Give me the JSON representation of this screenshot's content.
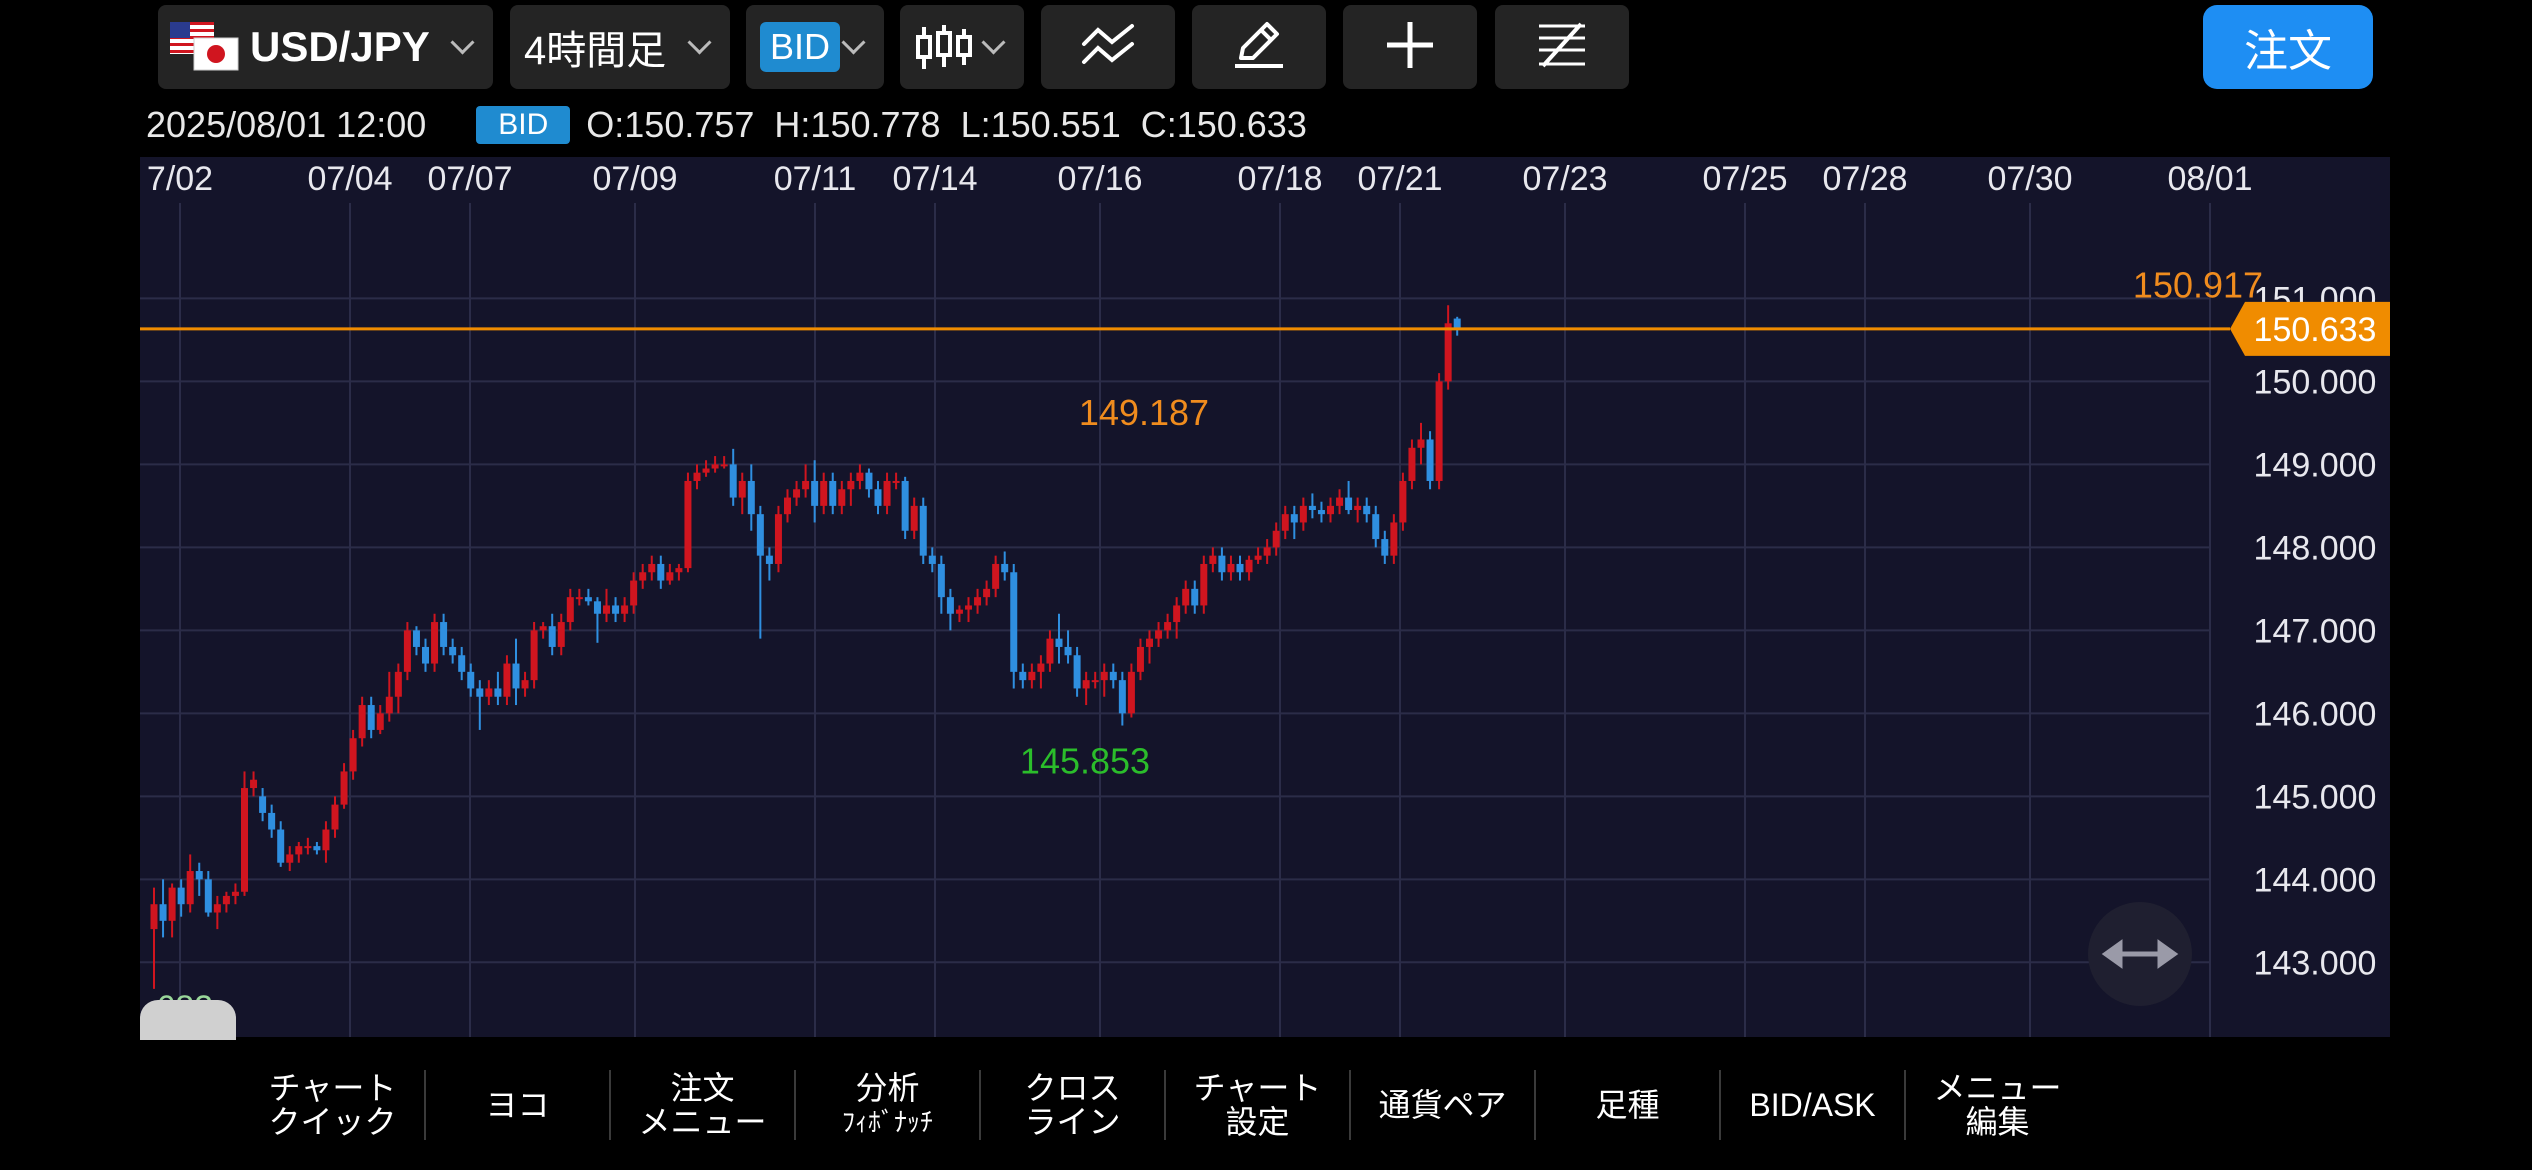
{
  "toolbar": {
    "pair": "USD/JPY",
    "timeframe": "4時間足",
    "price_side": "BID",
    "order_label": "注文",
    "icons": [
      "flag-us-jp-icon",
      "candlestick-icon",
      "indicator-lines-icon",
      "pencil-draw-icon",
      "crosshair-icon",
      "fibonacci-lines-icon"
    ]
  },
  "ohlc": {
    "datetime": "2025/08/01 12:00",
    "side": "BID",
    "open": "O:150.757",
    "high": "H:150.778",
    "low": "L:150.551",
    "close": "C:150.633"
  },
  "chart_annotations": {
    "current_price": "150.633",
    "high_label": "149.187",
    "low_label": "145.853",
    "recent_high_label": "150.917",
    "left_low_label": ".682"
  },
  "colors": {
    "up": "#d0151f",
    "down": "#2f8fe0",
    "price_line": "#f08c00",
    "high_text": "#f08c1e",
    "low_text": "#2bbd2b",
    "background": "#14142a",
    "order_button": "#1e8ef3"
  },
  "bottom_menu": [
    {
      "line1": "チャート",
      "line2": "クイック"
    },
    {
      "line1": "ヨコ",
      "line2": ""
    },
    {
      "line1": "注文",
      "line2": "メニュー"
    },
    {
      "line1": "分析",
      "line2": "ﾌｨﾎﾞﾅｯﾁ"
    },
    {
      "line1": "クロス",
      "line2": "ライン"
    },
    {
      "line1": "チャート",
      "line2": "設定"
    },
    {
      "line1": "通貨ペア",
      "line2": ""
    },
    {
      "line1": "足種",
      "line2": ""
    },
    {
      "line1": "BID/ASK",
      "line2": ""
    },
    {
      "line1": "メニュー",
      "line2": "編集"
    }
  ],
  "chart_data": {
    "type": "candlestick",
    "x_tick_labels": [
      "7/02",
      "07/04",
      "07/07",
      "07/09",
      "07/11",
      "07/14",
      "07/16",
      "07/18",
      "07/21",
      "07/23",
      "07/25",
      "07/28",
      "07/30",
      "08/01"
    ],
    "y_tick_labels": [
      "151.000",
      "150.000",
      "149.000",
      "148.000",
      "147.000",
      "146.000",
      "145.000",
      "144.000",
      "143.000"
    ],
    "y_range": [
      142.1,
      151.8
    ],
    "current_price": 150.633,
    "grid": true,
    "candles": [
      [
        143.4,
        143.9,
        142.68,
        143.7
      ],
      [
        143.7,
        144.0,
        143.3,
        143.5
      ],
      [
        143.5,
        143.95,
        143.3,
        143.9
      ],
      [
        143.9,
        144.0,
        143.55,
        143.7
      ],
      [
        143.7,
        144.3,
        143.6,
        144.1
      ],
      [
        144.1,
        144.2,
        143.8,
        144.0
      ],
      [
        144.0,
        144.1,
        143.55,
        143.6
      ],
      [
        143.6,
        143.8,
        143.4,
        143.7
      ],
      [
        143.7,
        143.85,
        143.6,
        143.8
      ],
      [
        143.8,
        143.95,
        143.7,
        143.85
      ],
      [
        143.85,
        145.3,
        143.8,
        145.1
      ],
      [
        145.1,
        145.3,
        145.0,
        145.2
      ],
      [
        145.0,
        145.1,
        144.7,
        144.8
      ],
      [
        144.8,
        144.9,
        144.5,
        144.6
      ],
      [
        144.6,
        144.7,
        144.15,
        144.2
      ],
      [
        144.2,
        144.4,
        144.1,
        144.3
      ],
      [
        144.3,
        144.45,
        144.2,
        144.4
      ],
      [
        144.4,
        144.5,
        144.3,
        144.4
      ],
      [
        144.4,
        144.45,
        144.3,
        144.35
      ],
      [
        144.35,
        144.7,
        144.2,
        144.6
      ],
      [
        144.6,
        145.0,
        144.5,
        144.9
      ],
      [
        144.9,
        145.4,
        144.85,
        145.3
      ],
      [
        145.3,
        145.8,
        145.2,
        145.7
      ],
      [
        145.7,
        146.2,
        145.6,
        146.1
      ],
      [
        146.1,
        146.2,
        145.7,
        145.8
      ],
      [
        145.8,
        146.1,
        145.75,
        146.0
      ],
      [
        146.0,
        146.5,
        145.9,
        146.2
      ],
      [
        146.2,
        146.6,
        146.0,
        146.5
      ],
      [
        146.5,
        147.1,
        146.4,
        147.0
      ],
      [
        147.0,
        147.05,
        146.7,
        146.8
      ],
      [
        146.8,
        146.9,
        146.5,
        146.6
      ],
      [
        146.6,
        147.2,
        146.5,
        147.1
      ],
      [
        147.1,
        147.2,
        146.7,
        146.8
      ],
      [
        146.8,
        146.9,
        146.6,
        146.7
      ],
      [
        146.7,
        146.8,
        146.4,
        146.5
      ],
      [
        146.5,
        146.6,
        146.2,
        146.3
      ],
      [
        146.3,
        146.4,
        145.8,
        146.2
      ],
      [
        146.2,
        146.4,
        146.1,
        146.3
      ],
      [
        146.3,
        146.5,
        146.1,
        146.2
      ],
      [
        146.2,
        146.7,
        146.1,
        146.6
      ],
      [
        146.6,
        146.9,
        146.1,
        146.3
      ],
      [
        146.3,
        146.5,
        146.2,
        146.4
      ],
      [
        146.4,
        147.1,
        146.3,
        147.0
      ],
      [
        147.0,
        147.1,
        146.9,
        147.05
      ],
      [
        147.05,
        147.2,
        146.7,
        146.8
      ],
      [
        146.8,
        147.2,
        146.7,
        147.1
      ],
      [
        147.1,
        147.5,
        147.0,
        147.4
      ],
      [
        147.4,
        147.5,
        147.3,
        147.4
      ],
      [
        147.4,
        147.5,
        147.3,
        147.35
      ],
      [
        147.35,
        147.4,
        146.85,
        147.2
      ],
      [
        147.2,
        147.5,
        147.1,
        147.3
      ],
      [
        147.3,
        147.4,
        147.1,
        147.2
      ],
      [
        147.2,
        147.4,
        147.1,
        147.3
      ],
      [
        147.3,
        147.7,
        147.2,
        147.6
      ],
      [
        147.6,
        147.8,
        147.5,
        147.7
      ],
      [
        147.7,
        147.9,
        147.6,
        147.8
      ],
      [
        147.8,
        147.9,
        147.5,
        147.6
      ],
      [
        147.6,
        147.8,
        147.55,
        147.7
      ],
      [
        147.7,
        147.8,
        147.6,
        147.75
      ],
      [
        147.75,
        148.9,
        147.7,
        148.8
      ],
      [
        148.8,
        149.0,
        148.7,
        148.9
      ],
      [
        148.9,
        149.05,
        148.85,
        148.95
      ],
      [
        148.95,
        149.1,
        148.9,
        149.0
      ],
      [
        149.0,
        149.1,
        148.95,
        149.0
      ],
      [
        149.0,
        149.187,
        148.5,
        148.6
      ],
      [
        148.6,
        148.9,
        148.4,
        148.8
      ],
      [
        148.8,
        149.0,
        148.2,
        148.4
      ],
      [
        148.4,
        148.5,
        146.9,
        147.9
      ],
      [
        147.9,
        148.0,
        147.6,
        147.8
      ],
      [
        147.8,
        148.5,
        147.7,
        148.4
      ],
      [
        148.4,
        148.7,
        148.3,
        148.6
      ],
      [
        148.6,
        148.8,
        148.5,
        148.7
      ],
      [
        148.7,
        149.0,
        148.6,
        148.8
      ],
      [
        148.8,
        149.05,
        148.3,
        148.5
      ],
      [
        148.5,
        148.9,
        148.4,
        148.8
      ],
      [
        148.8,
        148.9,
        148.4,
        148.5
      ],
      [
        148.5,
        148.8,
        148.4,
        148.7
      ],
      [
        148.7,
        148.9,
        148.5,
        148.8
      ],
      [
        148.8,
        149.0,
        148.7,
        148.9
      ],
      [
        148.9,
        148.95,
        148.6,
        148.7
      ],
      [
        148.7,
        148.8,
        148.4,
        148.5
      ],
      [
        148.5,
        148.9,
        148.4,
        148.8
      ],
      [
        148.8,
        148.9,
        148.7,
        148.8
      ],
      [
        148.8,
        148.85,
        148.1,
        148.2
      ],
      [
        148.2,
        148.6,
        148.1,
        148.5
      ],
      [
        148.5,
        148.6,
        147.8,
        147.9
      ],
      [
        147.9,
        148.0,
        147.7,
        147.8
      ],
      [
        147.8,
        147.9,
        147.2,
        147.4
      ],
      [
        147.4,
        147.5,
        147.0,
        147.2
      ],
      [
        147.2,
        147.3,
        147.1,
        147.25
      ],
      [
        147.25,
        147.4,
        147.1,
        147.3
      ],
      [
        147.3,
        147.5,
        147.2,
        147.4
      ],
      [
        147.4,
        147.6,
        147.3,
        147.5
      ],
      [
        147.5,
        147.9,
        147.4,
        147.8
      ],
      [
        147.8,
        147.95,
        147.6,
        147.7
      ],
      [
        147.7,
        147.8,
        146.3,
        146.5
      ],
      [
        146.5,
        146.6,
        146.3,
        146.4
      ],
      [
        146.4,
        146.6,
        146.3,
        146.5
      ],
      [
        146.5,
        146.7,
        146.3,
        146.6
      ],
      [
        146.6,
        147.0,
        146.5,
        146.9
      ],
      [
        146.9,
        147.2,
        146.6,
        146.8
      ],
      [
        146.8,
        147.0,
        146.6,
        146.7
      ],
      [
        146.7,
        146.8,
        146.2,
        146.3
      ],
      [
        146.3,
        146.5,
        146.1,
        146.4
      ],
      [
        146.4,
        146.5,
        146.3,
        146.4
      ],
      [
        146.4,
        146.6,
        146.2,
        146.5
      ],
      [
        146.5,
        146.6,
        146.3,
        146.4
      ],
      [
        146.4,
        146.5,
        145.853,
        146.0
      ],
      [
        146.0,
        146.6,
        145.95,
        146.5
      ],
      [
        146.5,
        146.9,
        146.4,
        146.8
      ],
      [
        146.8,
        147.0,
        146.6,
        146.9
      ],
      [
        146.9,
        147.1,
        146.8,
        147.0
      ],
      [
        147.0,
        147.2,
        146.9,
        147.1
      ],
      [
        147.1,
        147.4,
        146.9,
        147.3
      ],
      [
        147.3,
        147.6,
        147.2,
        147.5
      ],
      [
        147.5,
        147.6,
        147.2,
        147.3
      ],
      [
        147.3,
        147.9,
        147.2,
        147.8
      ],
      [
        147.8,
        148.0,
        147.7,
        147.9
      ],
      [
        147.9,
        148.0,
        147.6,
        147.7
      ],
      [
        147.7,
        147.9,
        147.6,
        147.8
      ],
      [
        147.8,
        147.9,
        147.6,
        147.7
      ],
      [
        147.7,
        147.9,
        147.6,
        147.85
      ],
      [
        147.85,
        148.0,
        147.8,
        147.9
      ],
      [
        147.9,
        148.1,
        147.8,
        148.0
      ],
      [
        148.0,
        148.3,
        147.9,
        148.2
      ],
      [
        148.2,
        148.5,
        148.1,
        148.4
      ],
      [
        148.4,
        148.5,
        148.1,
        148.3
      ],
      [
        148.3,
        148.6,
        148.2,
        148.5
      ],
      [
        148.5,
        148.65,
        148.35,
        148.45
      ],
      [
        148.45,
        148.55,
        148.3,
        148.4
      ],
      [
        148.4,
        148.6,
        148.3,
        148.5
      ],
      [
        148.5,
        148.7,
        148.4,
        148.6
      ],
      [
        148.6,
        148.8,
        148.4,
        148.45
      ],
      [
        148.45,
        148.6,
        148.3,
        148.5
      ],
      [
        148.5,
        148.6,
        148.3,
        148.4
      ],
      [
        148.4,
        148.5,
        148.0,
        148.1
      ],
      [
        148.1,
        148.2,
        147.8,
        147.9
      ],
      [
        147.9,
        148.4,
        147.8,
        148.3
      ],
      [
        148.3,
        148.9,
        148.2,
        148.8
      ],
      [
        148.8,
        149.3,
        148.7,
        149.2
      ],
      [
        149.2,
        149.5,
        149.0,
        149.3
      ],
      [
        149.3,
        149.4,
        148.7,
        148.8
      ],
      [
        148.8,
        150.1,
        148.7,
        150.0
      ],
      [
        150.0,
        150.917,
        149.9,
        150.7
      ],
      [
        150.757,
        150.778,
        150.551,
        150.633
      ]
    ]
  }
}
